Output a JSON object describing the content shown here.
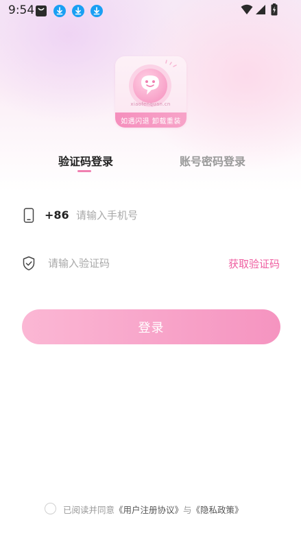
{
  "status_bar": {
    "time": "9:54"
  },
  "logo": {
    "url_text": "xiaofenquan.cn",
    "band_text": "如遇闪退 卸载重装"
  },
  "tabs": [
    {
      "label": "验证码登录",
      "active": true
    },
    {
      "label": "账号密码登录",
      "active": false
    }
  ],
  "phone_field": {
    "prefix": "+86",
    "placeholder": "请输入手机号",
    "value": ""
  },
  "code_field": {
    "placeholder": "请输入验证码",
    "value": "",
    "get_code_label": "获取验证码"
  },
  "login_button": {
    "label": "登录"
  },
  "agreement": {
    "prefix": "已阅读并同意",
    "user_agreement": "《用户注册协议》",
    "conjunction": "与",
    "privacy_policy": "《隐私政策》"
  },
  "colors": {
    "accent": "#ef5da0",
    "button_start": "#fbb7d4",
    "button_end": "#f594c0",
    "download_icon": "#1a9ff3"
  }
}
